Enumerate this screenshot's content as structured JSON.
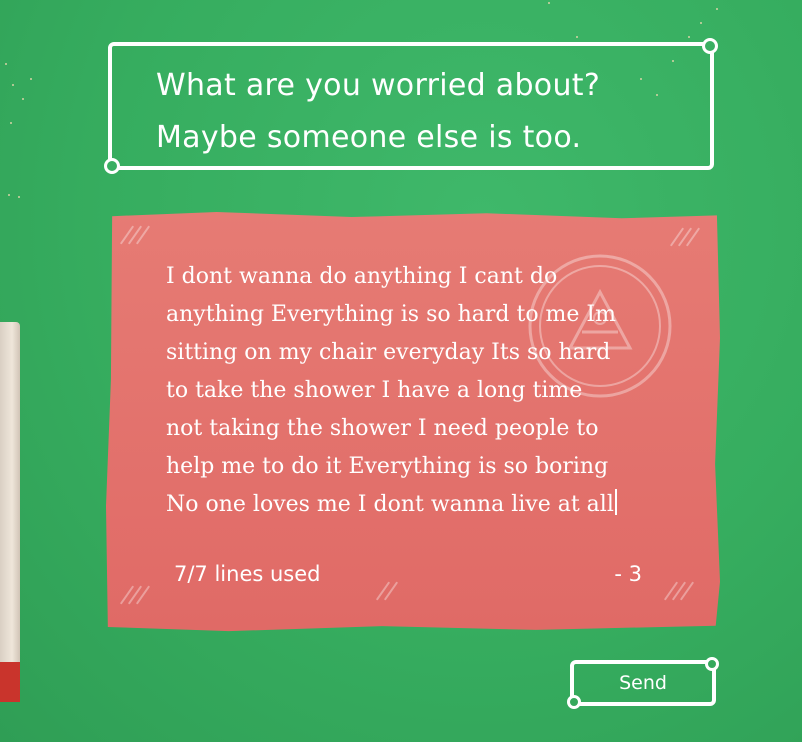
{
  "prompt": {
    "line1": "What are you worried about?",
    "line2": "Maybe someone else is too."
  },
  "note": {
    "lines": [
      "I dont wanna do anything I cant do",
      "anything Everything is so hard to me Im",
      "sitting on my chair everyday Its so hard",
      "to take the shower I have a long time",
      "not taking the shower I need people to",
      "help me to do it Everything is so boring",
      "No one loves me I dont wanna live at all"
    ],
    "lines_used": "7/7 lines used",
    "counter": "- 3"
  },
  "send_button": {
    "label": "Send"
  },
  "colors": {
    "background": "#3aaf62",
    "paper": "#e3706b",
    "text": "#ffffff"
  }
}
